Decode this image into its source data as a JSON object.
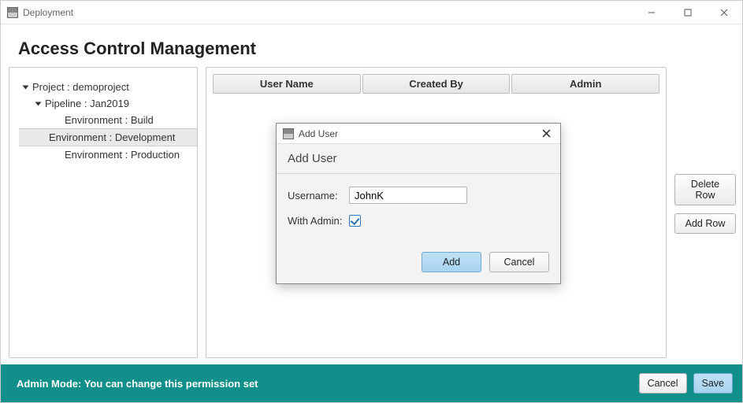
{
  "window": {
    "title": "Deployment"
  },
  "page": {
    "title": "Access Control Management"
  },
  "tree": {
    "project_label": "Project : demoproject",
    "pipeline_label": "Pipeline : Jan2019",
    "env_build": "Environment : Build",
    "env_dev": "Environment : Development",
    "env_prod": "Environment : Production"
  },
  "table": {
    "headers": {
      "user_name": "User Name",
      "created_by": "Created By",
      "admin": "Admin"
    }
  },
  "side": {
    "delete_row": "Delete Row",
    "add_row": "Add Row"
  },
  "dialog": {
    "window_title": "Add User",
    "header": "Add User",
    "username_label": "Username:",
    "username_value": "JohnK",
    "with_admin_label": "With Admin:",
    "with_admin_checked": true,
    "add": "Add",
    "cancel": "Cancel"
  },
  "footer": {
    "status": "Admin Mode: You can change this permission set",
    "cancel": "Cancel",
    "save": "Save"
  }
}
